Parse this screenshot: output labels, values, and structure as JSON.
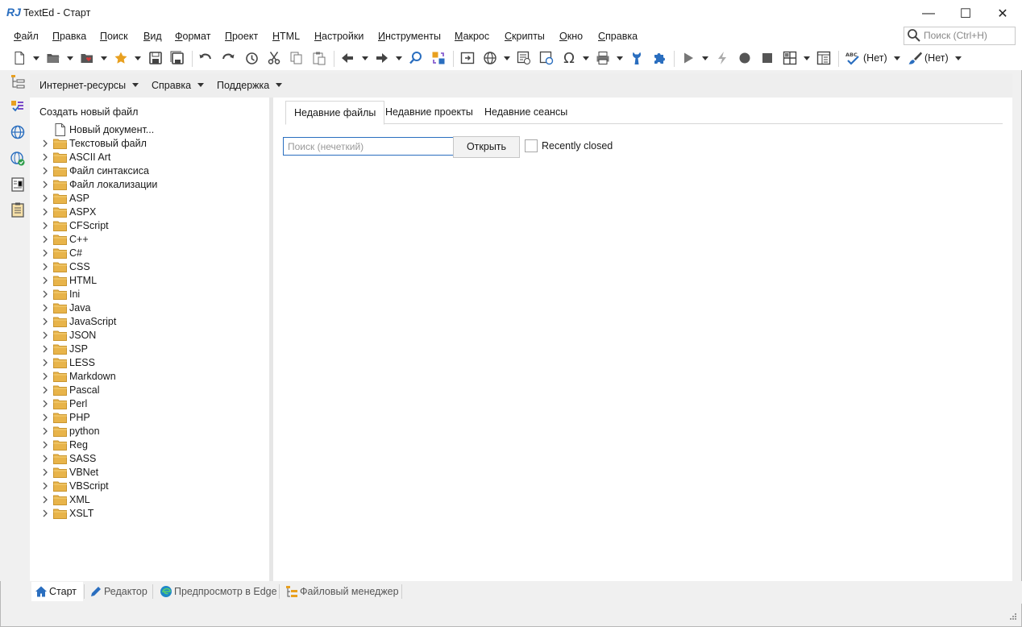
{
  "window": {
    "title": "TextEd - Старт",
    "logo_text": "RJ",
    "minimize_glyph": "—",
    "maximize_glyph": "☐",
    "close_glyph": "✕"
  },
  "menu": {
    "items": [
      "Файл",
      "Правка",
      "Поиск",
      "Вид",
      "Формат",
      "Проект",
      "HTML",
      "Настройки",
      "Инструменты",
      "Макрос",
      "Скрипты",
      "Окно",
      "Справка"
    ],
    "search_placeholder": "Поиск (Ctrl+H)"
  },
  "toolbar": {
    "spell_label": "(Нет)",
    "style_label": "(Нет)"
  },
  "panel_header": {
    "items": [
      "Интернет-ресурсы",
      "Справка",
      "Поддержка"
    ]
  },
  "tree": {
    "title": "Создать новый файл",
    "new_document": "Новый документ...",
    "folders": [
      "Текстовый файл",
      "ASCII Art",
      "Файл синтаксиса",
      "Файл локализации",
      "ASP",
      "ASPX",
      "CFScript",
      "C++",
      "C#",
      "CSS",
      "HTML",
      "Ini",
      "Java",
      "JavaScript",
      "JSON",
      "JSP",
      "LESS",
      "Markdown",
      "Pascal",
      "Perl",
      "PHP",
      "python",
      "Reg",
      "SASS",
      "VBNet",
      "VBScript",
      "XML",
      "XSLT"
    ]
  },
  "content": {
    "tabs": [
      "Недавние файлы",
      "Недавние проекты",
      "Недавние сеансы"
    ],
    "active_tab": 0,
    "search_placeholder": "Поиск (нечеткий)",
    "search_value": "",
    "open_button": "Открыть",
    "recently_closed_label": "Recently closed",
    "recently_closed_checked": false
  },
  "bottom_tabs": {
    "items": [
      "Старт",
      "Редактор",
      "Предпросмотр в Edge",
      "Файловый менеджер"
    ],
    "active": 0
  },
  "colors": {
    "accent": "#2a6ebf",
    "folder": "#e8b44a",
    "favorite": "#e8a020",
    "error_red": "#d23b3b"
  }
}
